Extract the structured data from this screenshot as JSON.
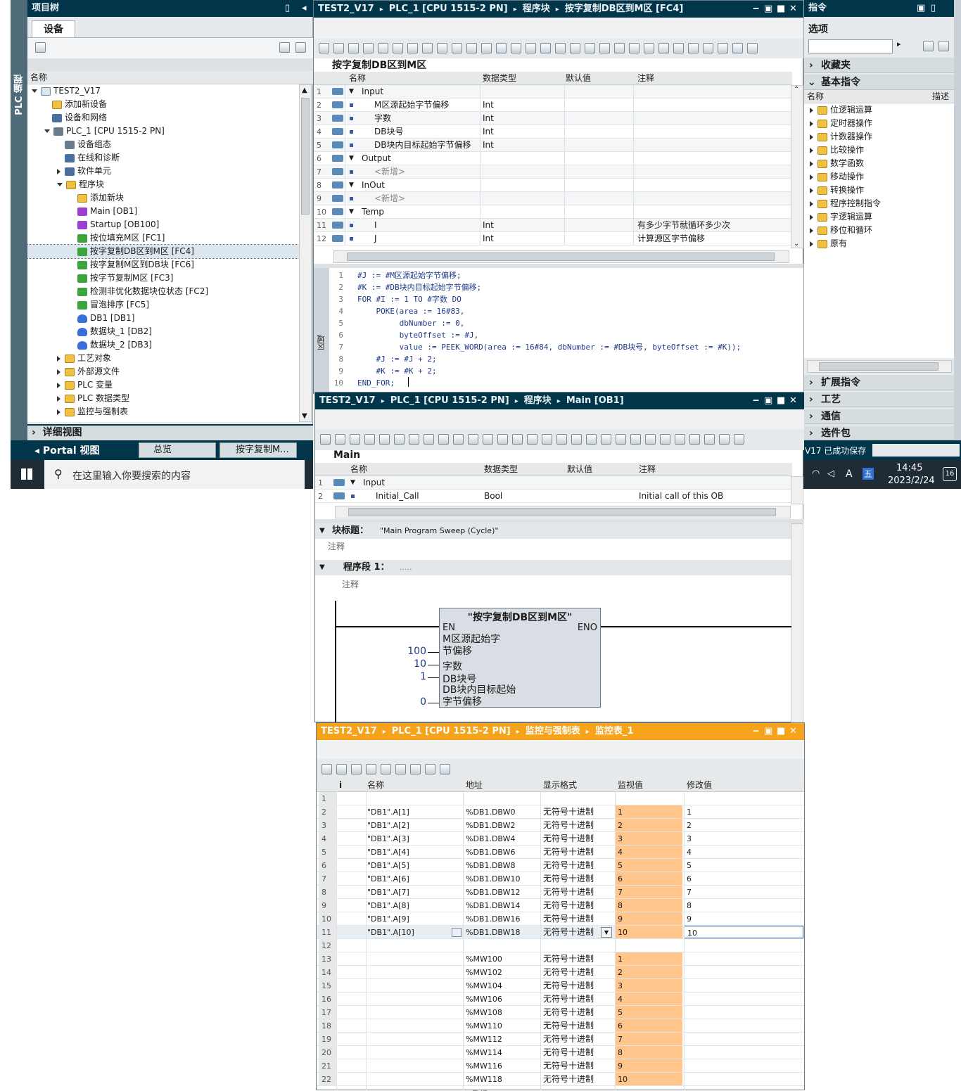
{
  "project_tree": {
    "title": "项目树",
    "side_label": "PLC 编程",
    "tab": "设备",
    "column_header": "名称",
    "items": [
      {
        "label": "TEST2_V17",
        "icon": "project-icon"
      },
      {
        "label": "添加新设备",
        "icon": "add-device-icon"
      },
      {
        "label": "设备和网络",
        "icon": "network-icon"
      },
      {
        "label": "PLC_1 [CPU 1515-2 PN]",
        "icon": "cpu-icon"
      },
      {
        "label": "设备组态",
        "icon": "device-config-icon"
      },
      {
        "label": "在线和诊断",
        "icon": "diagnostics-icon"
      },
      {
        "label": "软件单元",
        "icon": "software-unit-icon"
      },
      {
        "label": "程序块",
        "icon": "folder-icon"
      },
      {
        "label": "添加新块",
        "icon": "add-block-icon"
      },
      {
        "label": "Main [OB1]",
        "icon": "ob-icon"
      },
      {
        "label": "Startup [OB100]",
        "icon": "ob-icon"
      },
      {
        "label": "按位填充M区 [FC1]",
        "icon": "fc-icon"
      },
      {
        "label": "按字复制DB区到M区 [FC4]",
        "icon": "fc-icon"
      },
      {
        "label": "按字复制M区到DB块 [FC6]",
        "icon": "fc-icon"
      },
      {
        "label": "按字节复制M区 [FC3]",
        "icon": "fc-icon"
      },
      {
        "label": "检测非优化数据块位状态 [FC2]",
        "icon": "fc-icon"
      },
      {
        "label": "冒泡排序 [FC5]",
        "icon": "fc-icon"
      },
      {
        "label": "DB1 [DB1]",
        "icon": "db-icon"
      },
      {
        "label": "数据块_1 [DB2]",
        "icon": "db-icon"
      },
      {
        "label": "数据块_2 [DB3]",
        "icon": "db-icon"
      },
      {
        "label": "工艺对象",
        "icon": "folder-icon"
      },
      {
        "label": "外部源文件",
        "icon": "folder-icon"
      },
      {
        "label": "PLC 变量",
        "icon": "folder-icon"
      },
      {
        "label": "PLC 数据类型",
        "icon": "folder-icon"
      },
      {
        "label": "监控与强制表",
        "icon": "folder-icon"
      }
    ],
    "detail_view": "详细视图"
  },
  "taskbar_portal": {
    "portal_view": "Portal 视图",
    "tab_overview": "总览",
    "tab_fc": "按字复制M..."
  },
  "windows_taskbar": {
    "search_placeholder": "在这里输入你要搜索的内容",
    "time": "14:45",
    "date": "2023/2/24",
    "ime": "五",
    "ime_a": "A",
    "notification_count": "16",
    "save_status": "V17 已成功保存"
  },
  "fc4_editor": {
    "breadcrumb": [
      "TEST2_V17",
      "PLC_1 [CPU 1515-2 PN]",
      "程序块",
      "按字复制DB区到M区 [FC4]"
    ],
    "block_title": "按字复制DB区到M区",
    "headers": [
      "名称",
      "数据类型",
      "默认值",
      "注释"
    ],
    "rows": [
      {
        "n": "1",
        "name": "Input",
        "type": "",
        "comment": "",
        "section": true
      },
      {
        "n": "2",
        "name": "M区源起始字节偏移",
        "type": "Int",
        "comment": "",
        "section": false
      },
      {
        "n": "3",
        "name": "字数",
        "type": "Int",
        "comment": "",
        "section": false
      },
      {
        "n": "4",
        "name": "DB块号",
        "type": "Int",
        "comment": "",
        "section": false
      },
      {
        "n": "5",
        "name": "DB块内目标起始字节偏移",
        "type": "Int",
        "comment": "",
        "section": false
      },
      {
        "n": "6",
        "name": "Output",
        "type": "",
        "comment": "",
        "section": true
      },
      {
        "n": "7",
        "name": "<新增>",
        "type": "",
        "comment": "",
        "section": false
      },
      {
        "n": "8",
        "name": "InOut",
        "type": "",
        "comment": "",
        "section": true
      },
      {
        "n": "9",
        "name": "<新增>",
        "type": "",
        "comment": "",
        "section": false
      },
      {
        "n": "10",
        "name": "Temp",
        "type": "",
        "comment": "",
        "section": true
      },
      {
        "n": "11",
        "name": "I",
        "type": "Int",
        "comment": "有多少字节就循环多少次",
        "section": false
      },
      {
        "n": "12",
        "name": "J",
        "type": "Int",
        "comment": "计算源区字节偏移",
        "section": false
      }
    ],
    "side_label": "区域",
    "code": [
      "#J := #M区源起始字节偏移;",
      "#K := #DB块内目标起始字节偏移;",
      "FOR #I := 1 TO #字数 DO",
      "    POKE(area := 16#83,",
      "         dbNumber := 0,",
      "         byteOffset := #J,",
      "         value := PEEK_WORD(area := 16#84, dbNumber := #DB块号, byteOffset := #K));",
      "    #J := #J + 2;",
      "    #K := #K + 2;",
      "END_FOR;"
    ]
  },
  "instructions": {
    "title": "指令",
    "options": "选项",
    "favorites": "收藏夹",
    "basic": "基本指令",
    "col_name": "名称",
    "col_desc": "描述",
    "items": [
      "位逻辑运算",
      "定时器操作",
      "计数器操作",
      "比较操作",
      "数学函数",
      "移动操作",
      "转换操作",
      "程序控制指令",
      "字逻辑运算",
      "移位和循环",
      "原有"
    ],
    "extended": "扩展指令",
    "tech": "工艺",
    "comm": "通信",
    "optional": "选件包"
  },
  "ob1_editor": {
    "breadcrumb": [
      "TEST2_V17",
      "PLC_1 [CPU 1515-2 PN]",
      "程序块",
      "Main [OB1]"
    ],
    "block_title": "Main",
    "headers": [
      "名称",
      "数据类型",
      "默认值",
      "注释"
    ],
    "rows": [
      {
        "n": "1",
        "name": "Input",
        "type": "",
        "comment": ""
      },
      {
        "n": "2",
        "name": "Initial_Call",
        "type": "Bool",
        "comment": "Initial call of this OB"
      }
    ],
    "block_title_label": "块标题：",
    "block_title_value": "\"Main Program Sweep (Cycle)\"",
    "comment_label": "注释",
    "network_label": "程序段 1：",
    "network_dots": ".....",
    "fb": {
      "name": "\"按字复制DB区到M区\"",
      "en": "EN",
      "eno": "ENO",
      "pins": [
        {
          "label": "M区源起始字节偏移",
          "value": "100"
        },
        {
          "label": "字数",
          "value": "10"
        },
        {
          "label": "DB块号",
          "value": "1"
        },
        {
          "label": "DB块内目标起始字节偏移",
          "value": "0"
        }
      ]
    }
  },
  "watch_table": {
    "breadcrumb": [
      "TEST2_V17",
      "PLC_1 [CPU 1515-2 PN]",
      "监控与强制表",
      "监控表_1"
    ],
    "headers": [
      "i",
      "名称",
      "地址",
      "显示格式",
      "监视值",
      "修改值"
    ],
    "rows": [
      {
        "n": "1",
        "name": "",
        "addr": "",
        "fmt": "",
        "mon": "",
        "mod": ""
      },
      {
        "n": "2",
        "name": "\"DB1\".A[1]",
        "addr": "%DB1.DBW0",
        "fmt": "无符号十进制",
        "mon": "1",
        "mod": "1"
      },
      {
        "n": "3",
        "name": "\"DB1\".A[2]",
        "addr": "%DB1.DBW2",
        "fmt": "无符号十进制",
        "mon": "2",
        "mod": "2"
      },
      {
        "n": "4",
        "name": "\"DB1\".A[3]",
        "addr": "%DB1.DBW4",
        "fmt": "无符号十进制",
        "mon": "3",
        "mod": "3"
      },
      {
        "n": "5",
        "name": "\"DB1\".A[4]",
        "addr": "%DB1.DBW6",
        "fmt": "无符号十进制",
        "mon": "4",
        "mod": "4"
      },
      {
        "n": "6",
        "name": "\"DB1\".A[5]",
        "addr": "%DB1.DBW8",
        "fmt": "无符号十进制",
        "mon": "5",
        "mod": "5"
      },
      {
        "n": "7",
        "name": "\"DB1\".A[6]",
        "addr": "%DB1.DBW10",
        "fmt": "无符号十进制",
        "mon": "6",
        "mod": "6"
      },
      {
        "n": "8",
        "name": "\"DB1\".A[7]",
        "addr": "%DB1.DBW12",
        "fmt": "无符号十进制",
        "mon": "7",
        "mod": "7"
      },
      {
        "n": "9",
        "name": "\"DB1\".A[8]",
        "addr": "%DB1.DBW14",
        "fmt": "无符号十进制",
        "mon": "8",
        "mod": "8"
      },
      {
        "n": "10",
        "name": "\"DB1\".A[9]",
        "addr": "%DB1.DBW16",
        "fmt": "无符号十进制",
        "mon": "9",
        "mod": "9"
      },
      {
        "n": "11",
        "name": "\"DB1\".A[10]",
        "addr": "%DB1.DBW18",
        "fmt": "无符号十进制",
        "mon": "10",
        "mod": "10"
      },
      {
        "n": "12",
        "name": "",
        "addr": "",
        "fmt": "",
        "mon": "",
        "mod": ""
      },
      {
        "n": "13",
        "name": "",
        "addr": "%MW100",
        "fmt": "无符号十进制",
        "mon": "1",
        "mod": ""
      },
      {
        "n": "14",
        "name": "",
        "addr": "%MW102",
        "fmt": "无符号十进制",
        "mon": "2",
        "mod": ""
      },
      {
        "n": "15",
        "name": "",
        "addr": "%MW104",
        "fmt": "无符号十进制",
        "mon": "3",
        "mod": ""
      },
      {
        "n": "16",
        "name": "",
        "addr": "%MW106",
        "fmt": "无符号十进制",
        "mon": "4",
        "mod": ""
      },
      {
        "n": "17",
        "name": "",
        "addr": "%MW108",
        "fmt": "无符号十进制",
        "mon": "5",
        "mod": ""
      },
      {
        "n": "18",
        "name": "",
        "addr": "%MW110",
        "fmt": "无符号十进制",
        "mon": "6",
        "mod": ""
      },
      {
        "n": "19",
        "name": "",
        "addr": "%MW112",
        "fmt": "无符号十进制",
        "mon": "7",
        "mod": ""
      },
      {
        "n": "20",
        "name": "",
        "addr": "%MW114",
        "fmt": "无符号十进制",
        "mon": "8",
        "mod": ""
      },
      {
        "n": "21",
        "name": "",
        "addr": "%MW116",
        "fmt": "无符号十进制",
        "mon": "9",
        "mod": ""
      },
      {
        "n": "22",
        "name": "",
        "addr": "%MW118",
        "fmt": "无符号十进制",
        "mon": "10",
        "mod": ""
      }
    ],
    "trailing_partial": "<新增>"
  },
  "colors": {
    "title_dark": "#00354a",
    "title_orange": "#f6a21a",
    "monitor_fill": "#ffc58b"
  }
}
